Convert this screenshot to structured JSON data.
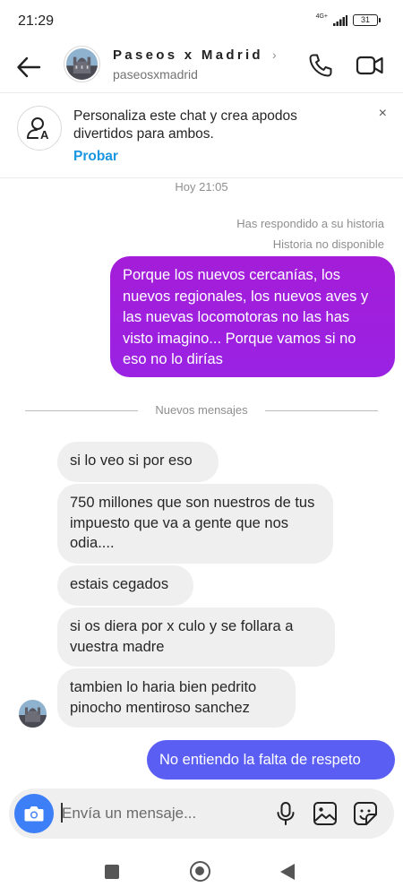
{
  "status_bar": {
    "time": "21:29",
    "network": "4G+",
    "battery": "31"
  },
  "header": {
    "contact_name": "Paseos x Madrid",
    "contact_handle": "paseosxmadrid",
    "chevron": "›",
    "icons": {
      "back": "arrow-left-icon",
      "call": "phone-icon",
      "video": "video-camera-icon"
    }
  },
  "banner": {
    "text": "Personaliza este chat y crea apodos divertidos para ambos.",
    "link": "Probar",
    "close": "×",
    "icon": "nickname-icon"
  },
  "conversation": {
    "timestamp": "Hoy 21:05",
    "story_reply_note": "Has respondido a su historia",
    "story_unavailable": "Historia no disponible",
    "outgoing_1": "Porque los nuevos cercanías, los nuevos regionales, los nuevos aves y las nuevas locomotoras no las has visto imagino... Porque vamos si no eso no lo dirías",
    "new_messages_label": "Nuevos mensajes",
    "incoming": [
      "si lo veo si por eso",
      "750 millones que son nuestros de tus impuesto que va a gente que nos odia....",
      "estais cegados",
      "si os diera por x culo y se follara a vuestra madre",
      "tambien lo haria bien pedrito pinocho mentiroso sanchez"
    ],
    "outgoing_2": "No entiendo la falta de respeto"
  },
  "composer": {
    "placeholder": "Envía un mensaje...",
    "icons": {
      "camera": "camera-icon",
      "mic": "microphone-icon",
      "gallery": "image-icon",
      "sticker": "sticker-icon"
    }
  },
  "colors": {
    "outgoing_bubble": "#9a22e3",
    "outgoing_bubble_last": "#5a5ef2",
    "incoming_bubble": "#efefef",
    "link": "#1a95e0",
    "camera_button": "#3d7ff6"
  }
}
